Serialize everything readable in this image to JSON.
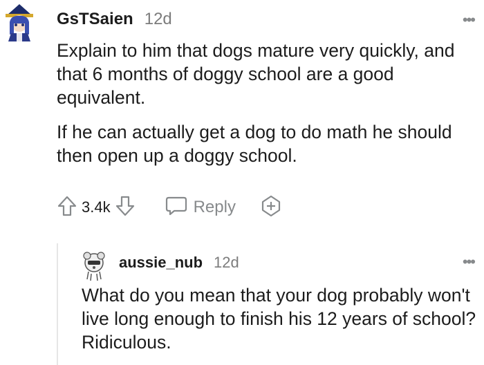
{
  "comment": {
    "username": "GsTSaien",
    "timestamp": "12d",
    "paragraphs": [
      "Explain to him that dogs mature very quickly, and that 6 months of doggy school are a good equivalent.",
      "If he can actually get a dog to do math he should then open up a doggy school."
    ],
    "score": "3.4k",
    "reply_label": "Reply",
    "more_icon": "more-options-icon",
    "upvote_icon": "upvote-arrow-icon",
    "downvote_icon": "downvote-arrow-icon",
    "reply_icon": "speech-bubble-icon",
    "award_icon": "add-award-icon"
  },
  "reply": {
    "username": "aussie_nub",
    "timestamp": "12d",
    "text": "What do you mean that your dog probably won't live long enough to finish his 12 years of school? Ridiculous."
  },
  "colors": {
    "text": "#1c1c1c",
    "muted": "#7c7c7c",
    "icon": "#878a8c",
    "thread_line": "#e6e6e6"
  }
}
